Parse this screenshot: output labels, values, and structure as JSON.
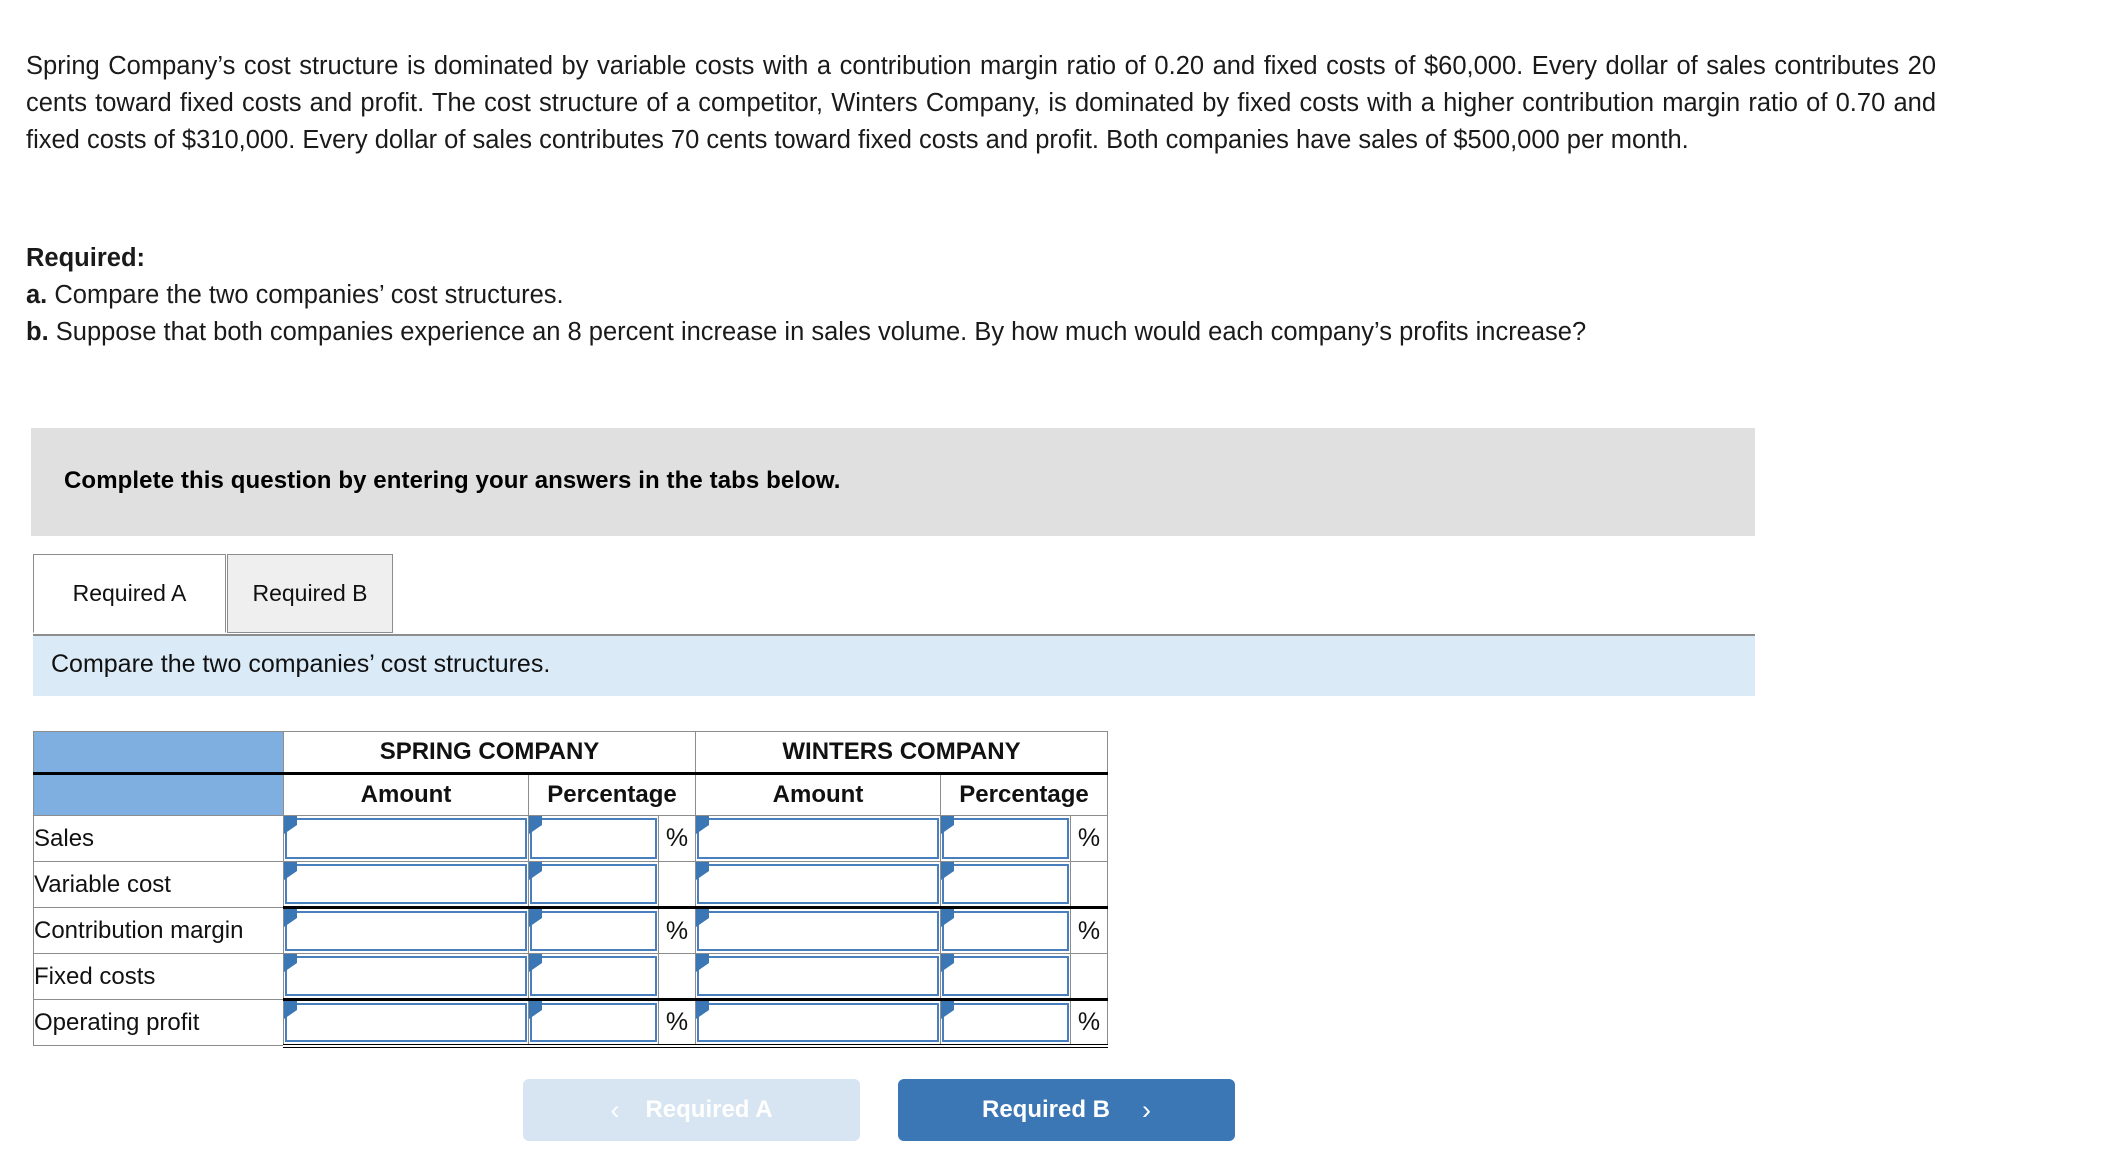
{
  "question": {
    "paragraph": "Spring Company’s cost structure is dominated by variable costs with a contribution margin ratio of 0.20 and fixed costs of $60,000. Every dollar of sales contributes 20 cents toward fixed costs and profit. The cost structure of a competitor, Winters Company, is dominated by fixed costs with a higher contribution margin ratio of 0.70 and fixed costs of $310,000. Every dollar of sales contributes 70 cents toward fixed costs and profit. Both companies have sales of $500,000 per month.",
    "required_heading": "Required:",
    "items": [
      {
        "letter": "a.",
        "text": "Compare the two companies’ cost structures."
      },
      {
        "letter": "b.",
        "text": "Suppose that both companies experience an 8 percent increase in sales volume. By how much would each company’s profits increase?"
      }
    ]
  },
  "instruction_banner": {
    "text": "Complete this question by entering your answers in the tabs below."
  },
  "tabs": [
    {
      "id": "required-a",
      "label": "Required A",
      "active": true
    },
    {
      "id": "required-b",
      "label": "Required B",
      "active": false
    }
  ],
  "sub_instruction": {
    "text": "Compare the two companies’ cost structures."
  },
  "table": {
    "group_headers": [
      "",
      "SPRING COMPANY",
      "WINTERS COMPANY"
    ],
    "sub_headers": [
      "",
      "Amount",
      "Percentage",
      "Amount",
      "Percentage"
    ],
    "percent_symbol": "%",
    "rows": [
      {
        "label": "Sales",
        "spring_amount": "",
        "spring_percentage": "",
        "spring_pct_symbol": "%",
        "winters_amount": "",
        "winters_percentage": "",
        "winters_pct_symbol": "%",
        "rule": "none"
      },
      {
        "label": "Variable cost",
        "spring_amount": "",
        "spring_percentage": "",
        "spring_pct_symbol": "",
        "winters_amount": "",
        "winters_percentage": "",
        "winters_pct_symbol": "",
        "rule": "single"
      },
      {
        "label": "Contribution margin",
        "spring_amount": "",
        "spring_percentage": "",
        "spring_pct_symbol": "%",
        "winters_amount": "",
        "winters_percentage": "",
        "winters_pct_symbol": "%",
        "rule": "none"
      },
      {
        "label": "Fixed costs",
        "spring_amount": "",
        "spring_percentage": "",
        "spring_pct_symbol": "",
        "winters_amount": "",
        "winters_percentage": "",
        "winters_pct_symbol": "",
        "rule": "single"
      },
      {
        "label": "Operating profit",
        "spring_amount": "",
        "spring_percentage": "",
        "spring_pct_symbol": "%",
        "winters_amount": "",
        "winters_percentage": "",
        "winters_pct_symbol": "%",
        "rule": "double"
      }
    ]
  },
  "footer": {
    "prev": {
      "label": "Required A",
      "chevron": "‹",
      "enabled": false
    },
    "next": {
      "label": "Required B",
      "chevron": "›",
      "enabled": true
    }
  },
  "colors": {
    "header_blue": "#7fafe0",
    "input_border_blue": "#4a7fbd",
    "marker_blue": "#3b76b5",
    "banner_gray": "#e0e0e0",
    "sub_instruction_blue": "#daeaf7",
    "primary_button": "#3b76b5",
    "disabled_button": "#d7e4f2"
  }
}
